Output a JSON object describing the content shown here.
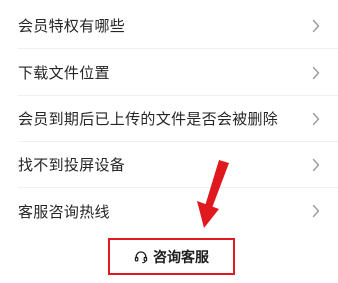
{
  "faq": {
    "items": [
      {
        "label": "会员特权有哪些"
      },
      {
        "label": "下载文件位置"
      },
      {
        "label": "会员到期后已上传的文件是否会被删除"
      },
      {
        "label": "找不到投屏设备"
      },
      {
        "label": "客服咨询热线"
      }
    ]
  },
  "footer": {
    "contact_label": "咨询客服",
    "contact_icon": "headset-icon"
  },
  "annotation": {
    "color": "#e0191f"
  }
}
